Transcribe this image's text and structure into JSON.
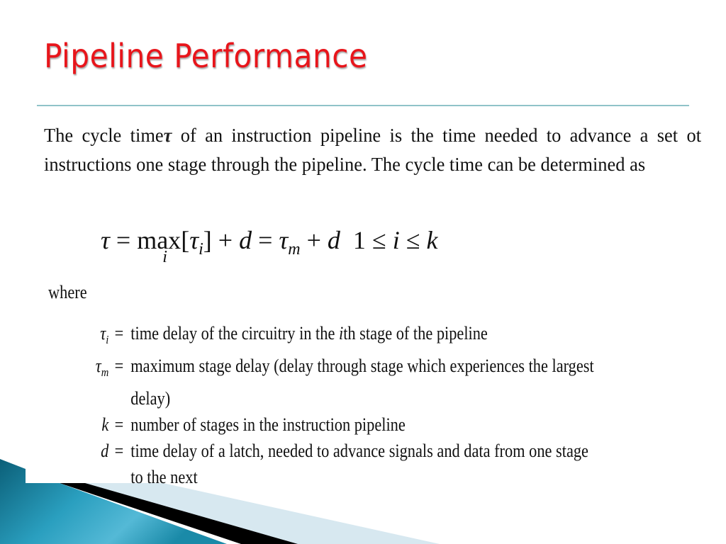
{
  "slide": {
    "title": "Pipeline Performance",
    "paragraph": {
      "before_symbol": "The cycle time",
      "symbol": "τ",
      "after_symbol": " of an  instruction pipeline is the time needed to advance a set ot instructions one stage  through the pipeline. The cycle time can be determined as"
    },
    "formula": {
      "lhs": "τ",
      "eq1": " = ",
      "max": "max",
      "max_sub": "i",
      "bracket_open": "[",
      "tau_i": "τ",
      "tau_i_sub": "i",
      "bracket_close": "]",
      "plus1": " + ",
      "d1": "d",
      "eq2": " = ",
      "tau_m": "τ",
      "tau_m_sub": "m",
      "plus2": " + ",
      "d2": "d",
      "range_1": "1",
      "le1": " ≤ ",
      "range_i": "i",
      "le2": " ≤ ",
      "range_k": "k"
    },
    "where_label": "where",
    "definitions": [
      {
        "symbol": "τ",
        "sub": "i",
        "text_before": "time delay of the circuitry in the ",
        "text_italic": "i",
        "text_after": "th stage of the pipeline"
      },
      {
        "symbol": "τ",
        "sub": "m",
        "text_before": "maximum stage delay (delay through stage which experiences the largest",
        "text_italic": "",
        "text_after": ""
      },
      {
        "symbol": "",
        "sub": "",
        "text_before": "delay)",
        "text_italic": "",
        "text_after": ""
      },
      {
        "symbol": "k",
        "sub": "",
        "text_before": "number of stages in the instruction pipeline",
        "text_italic": "",
        "text_after": ""
      },
      {
        "symbol": "d",
        "sub": "",
        "text_before": "time delay of a latch, needed to advance signals and data from one stage",
        "text_italic": "",
        "text_after": ""
      },
      {
        "symbol": "",
        "sub": "",
        "text_before": "to the next",
        "text_italic": "",
        "text_after": ""
      }
    ],
    "equals_sign": "=",
    "colors": {
      "title": "#e8151b",
      "rule": "#8fc3c9",
      "accent_dark": "#0e6f86",
      "accent_light": "#4fb5d0",
      "accent_pale": "#d7e8f0"
    }
  }
}
